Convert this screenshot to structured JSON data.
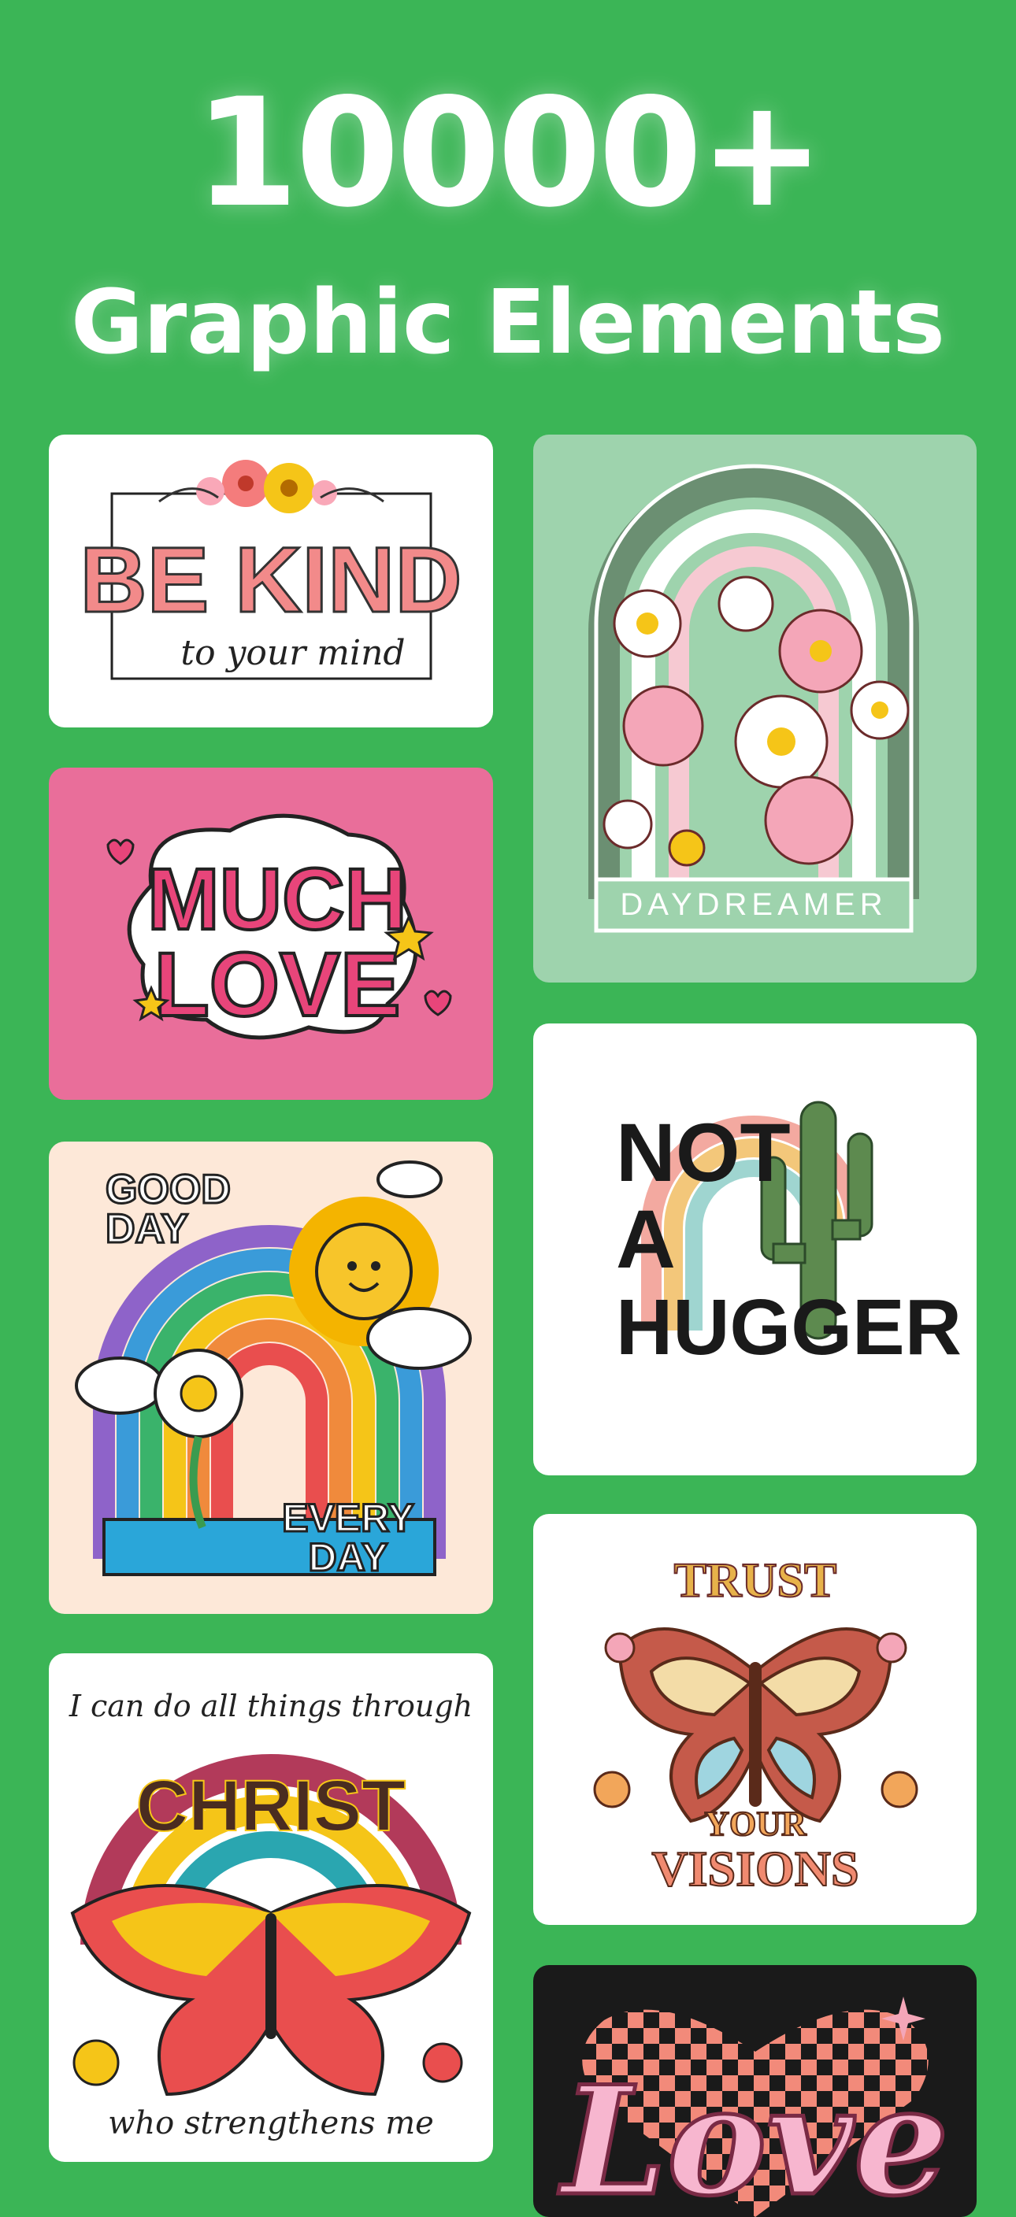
{
  "hero": {
    "count": "10000+",
    "subtitle": "Graphic Elements"
  },
  "colors": {
    "background": "#3bb556",
    "text": "#ffffff"
  },
  "gallery": [
    {
      "title": "BE KIND",
      "subtitle": "to your mind"
    },
    {
      "title": "MUCH",
      "subtitle": "LOVE"
    },
    {
      "title": "GOOD",
      "subtitle": "DAY",
      "footer_1": "EVERY",
      "footer_2": "DAY"
    },
    {
      "title": "CHRIST",
      "top_script": "I can do all things through",
      "bottom_script": "who strengthens me"
    },
    {
      "title": "DAYDREAMER"
    },
    {
      "title": "NOT",
      "line_2": "A",
      "line_3": "HUGGER"
    },
    {
      "title": "TRUST",
      "line_2": "YOUR",
      "line_3": "VISIONS"
    },
    {
      "title": "Love"
    }
  ]
}
